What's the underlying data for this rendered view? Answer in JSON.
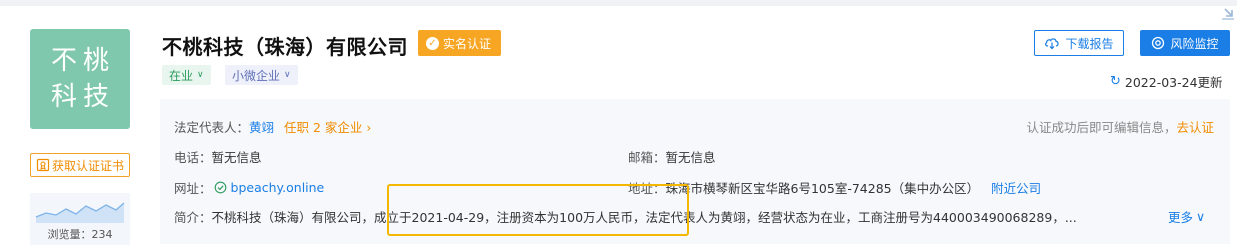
{
  "company": {
    "logo_line1": "不桃",
    "logo_line2": "科技",
    "name": "不桃科技（珠海）有限公司",
    "verified_label": "实名认证",
    "status_tag": "在业",
    "size_tag": "小微企业"
  },
  "sidebar": {
    "cert_button": "获取认证证书",
    "views_label": "浏览量：",
    "views_count": "234"
  },
  "actions": {
    "download": "下载报告",
    "monitor": "风险监控",
    "updated": "2022-03-24更新"
  },
  "info": {
    "rep_label": "法定代表人：",
    "rep_name": "黄翊",
    "rep_jobs": "任职 2 家企业",
    "edit_hint": "认证成功后即可编辑信息，",
    "edit_link": "去认证",
    "phone_label": "电话：",
    "phone_value": "暂无信息",
    "email_label": "邮箱：",
    "email_value": "暂无信息",
    "website_label": "网址：",
    "website_value": "bpeachy.online",
    "address_label": "地址：",
    "address_value": "珠海市横琴新区宝华路6号105室-74285（集中办公区）",
    "address_link": "附近公司",
    "summary_label": "简介：",
    "summary_value": "不桃科技（珠海）有限公司，成立于2021-04-29，注册资本为100万人民币，法定代表人为黄翊，经营状态为在业，工商注册号为440003490068289，...",
    "more": "更多"
  },
  "colors": {
    "logo_bg": "#7fc8ad",
    "accent_blue": "#1a7ee6",
    "accent_orange": "#f6a623",
    "highlight": "#f5b800"
  }
}
